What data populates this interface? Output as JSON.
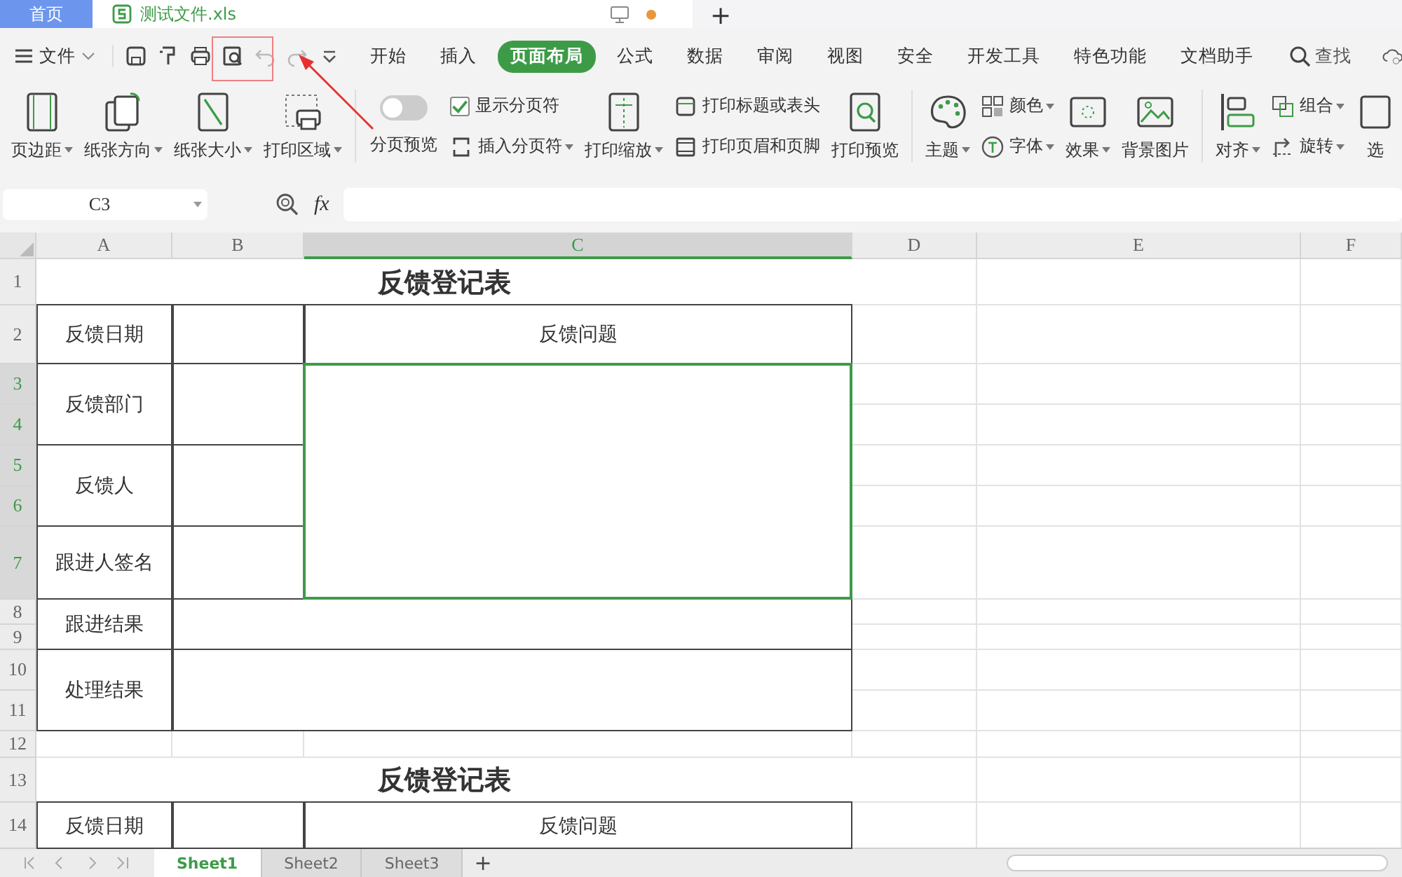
{
  "doc_tabs": [
    {
      "label": "首页",
      "kind": "home",
      "selected": false
    },
    {
      "label": "测试文件.xls",
      "kind": "file",
      "selected": true,
      "unsaved": true
    }
  ],
  "new_tab": "+",
  "menu": {
    "file": "文件",
    "tabs": [
      {
        "label": "开始",
        "selected": false
      },
      {
        "label": "插入",
        "selected": false
      },
      {
        "label": "页面布局",
        "selected": true
      },
      {
        "label": "公式",
        "selected": false
      },
      {
        "label": "数据",
        "selected": false
      },
      {
        "label": "审阅",
        "selected": false
      },
      {
        "label": "视图",
        "selected": false
      },
      {
        "label": "安全",
        "selected": false
      },
      {
        "label": "开发工具",
        "selected": false
      },
      {
        "label": "特色功能",
        "selected": false
      },
      {
        "label": "文档助手",
        "selected": false
      }
    ],
    "search": "查找"
  },
  "ribbon": [
    {
      "kind": "big",
      "label": "页边距",
      "dropdown": true
    },
    {
      "kind": "big",
      "label": "纸张方向",
      "dropdown": true
    },
    {
      "kind": "big",
      "label": "纸张大小",
      "dropdown": true
    },
    {
      "kind": "big",
      "label": "打印区域",
      "dropdown": true
    },
    {
      "kind": "separator"
    },
    {
      "kind": "toggle",
      "label": "分页预览",
      "on": false
    },
    {
      "kind": "stack",
      "items": [
        {
          "kind": "check",
          "label": "显示分页符",
          "checked": true
        },
        {
          "kind": "small",
          "label": "插入分页符",
          "dropdown": true
        }
      ]
    },
    {
      "kind": "big",
      "label": "打印缩放",
      "dropdown": true
    },
    {
      "kind": "stack",
      "items": [
        {
          "kind": "small",
          "label": "打印标题或表头",
          "dropdown": false
        },
        {
          "kind": "small",
          "label": "打印页眉和页脚",
          "dropdown": false
        }
      ]
    },
    {
      "kind": "big",
      "label": "打印预览",
      "dropdown": false
    },
    {
      "kind": "separator"
    },
    {
      "kind": "big",
      "label": "主题",
      "dropdown": true
    },
    {
      "kind": "stack",
      "items": [
        {
          "kind": "small",
          "label": "颜色",
          "dropdown": true
        },
        {
          "kind": "small",
          "label": "字体",
          "dropdown": true
        }
      ]
    },
    {
      "kind": "big",
      "label": "效果",
      "dropdown": true
    },
    {
      "kind": "big",
      "label": "背景图片",
      "dropdown": false
    },
    {
      "kind": "separator"
    },
    {
      "kind": "big",
      "label": "对齐",
      "dropdown": true
    },
    {
      "kind": "stack",
      "items": [
        {
          "kind": "small",
          "label": "组合",
          "dropdown": true
        },
        {
          "kind": "small",
          "label": "旋转",
          "dropdown": true
        }
      ]
    },
    {
      "kind": "big",
      "label": "选",
      "dropdown": false
    }
  ],
  "formula_bar": {
    "name_box": "C3",
    "fx": "fx"
  },
  "columns": [
    {
      "label": "A",
      "selected": false
    },
    {
      "label": "B",
      "selected": false
    },
    {
      "label": "C",
      "selected": true
    },
    {
      "label": "D",
      "selected": false
    },
    {
      "label": "E",
      "selected": false
    },
    {
      "label": "F",
      "selected": false
    }
  ],
  "rows": [
    {
      "label": "1",
      "selected": false
    },
    {
      "label": "2",
      "selected": false
    },
    {
      "label": "3",
      "selected": true
    },
    {
      "label": "4",
      "selected": true
    },
    {
      "label": "5",
      "selected": true
    },
    {
      "label": "6",
      "selected": true
    },
    {
      "label": "7",
      "selected": true
    },
    {
      "label": "8",
      "selected": false
    },
    {
      "label": "9",
      "selected": false
    },
    {
      "label": "10",
      "selected": false
    },
    {
      "label": "11",
      "selected": false
    },
    {
      "label": "12",
      "selected": false
    },
    {
      "label": "13",
      "selected": false
    },
    {
      "label": "14",
      "selected": false
    }
  ],
  "cells": [
    {
      "kind": "title",
      "text": "反馈登记表",
      "selected": false
    },
    {
      "kind": "cell",
      "text": "反馈日期",
      "selected": false
    },
    {
      "kind": "cell",
      "text": "反馈问题",
      "selected": false
    },
    {
      "kind": "cell",
      "text": "反馈部门",
      "selected": false
    },
    {
      "kind": "cell",
      "selected": true
    },
    {
      "kind": "cell",
      "text": "反馈人",
      "selected": false
    },
    {
      "kind": "cell",
      "text": "跟进人签名",
      "selected": false
    },
    {
      "kind": "cell",
      "text": "跟进结果",
      "selected": false
    },
    {
      "kind": "cell",
      "text": "处理结果",
      "selected": false
    },
    {
      "kind": "title",
      "text": "反馈登记表",
      "selected": false
    },
    {
      "kind": "cell",
      "text": "反馈日期",
      "selected": false
    },
    {
      "kind": "cell",
      "text": "反馈问题",
      "selected": false
    }
  ],
  "sheets": [
    {
      "label": "Sheet1",
      "selected": true
    },
    {
      "label": "Sheet2",
      "selected": false
    },
    {
      "label": "Sheet3",
      "selected": false
    }
  ],
  "add_sheet": "+"
}
